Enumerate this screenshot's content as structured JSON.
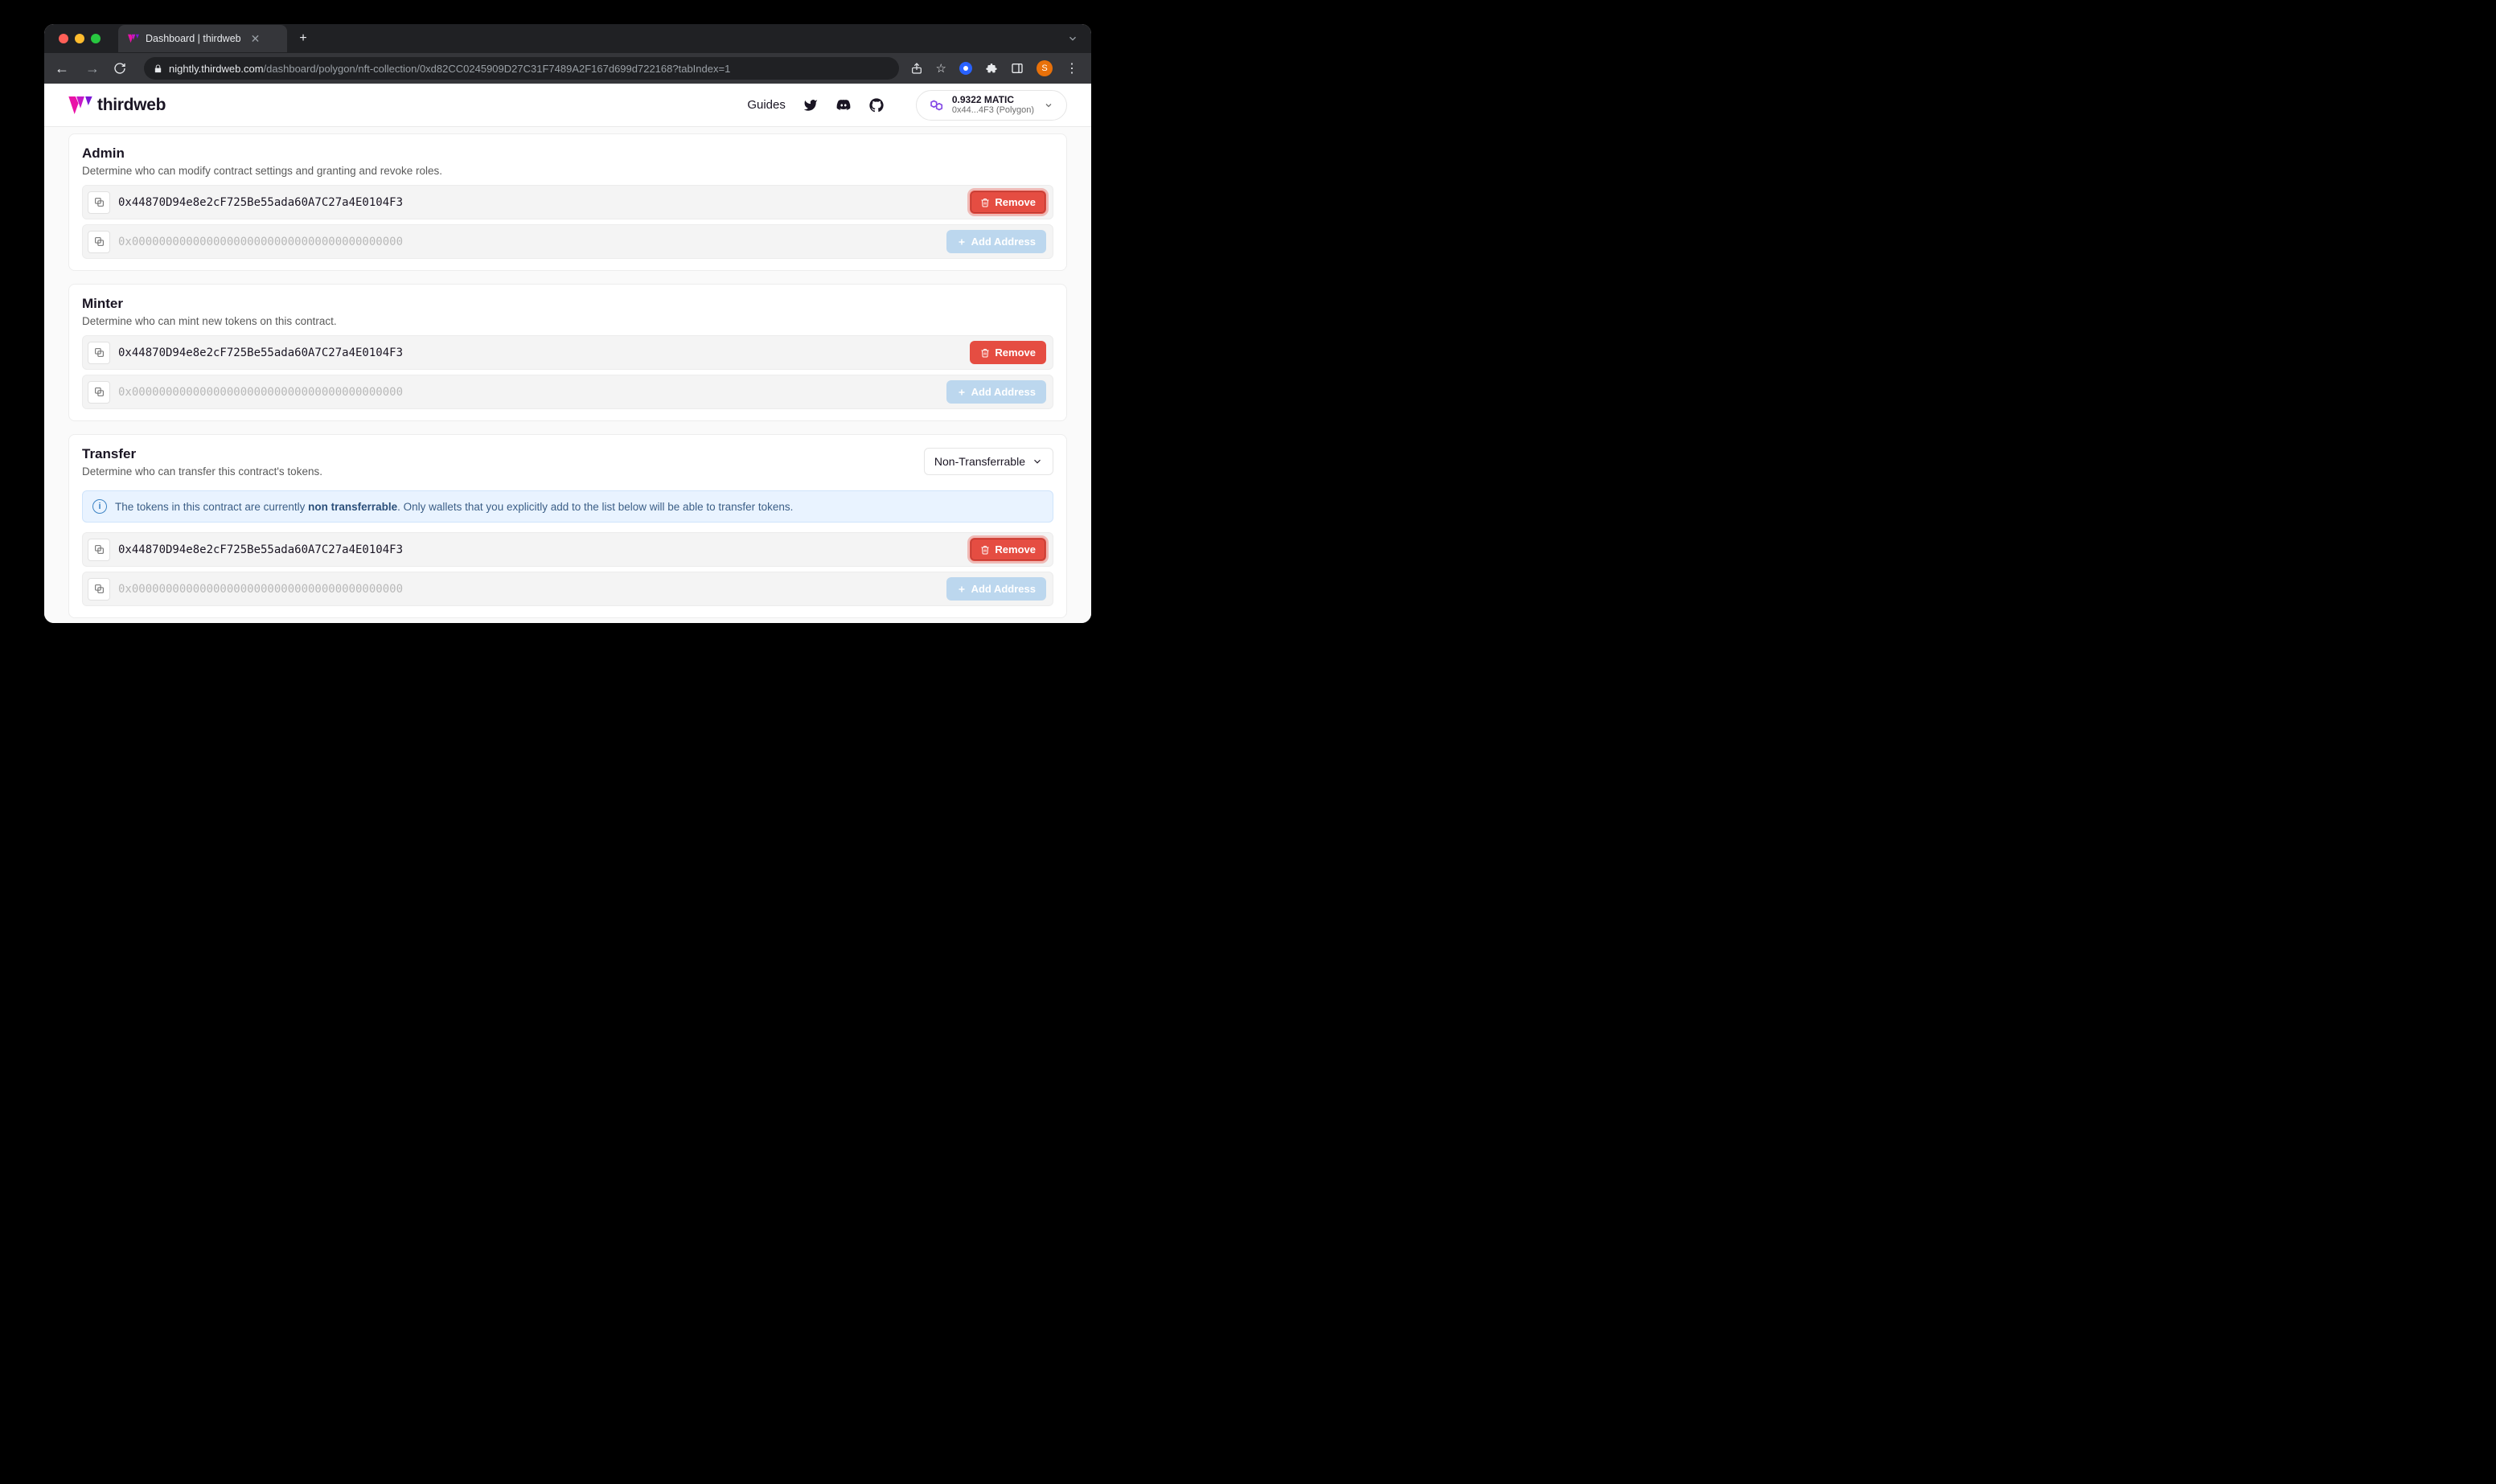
{
  "browser": {
    "tab_title": "Dashboard | thirdweb",
    "url_host": "nightly.thirdweb.com",
    "url_path": "/dashboard/polygon/nft-collection/0xd82CC0245909D27C31F7489A2F167d699d722168?tabIndex=1",
    "avatar_letter": "S"
  },
  "header": {
    "brand": "thirdweb",
    "guides_label": "Guides",
    "wallet_balance": "0.9322 MATIC",
    "wallet_short": "0x44...4F3 (Polygon)"
  },
  "labels": {
    "remove": "Remove",
    "add_address": "Add Address"
  },
  "placeholder_addr": "0x0000000000000000000000000000000000000000",
  "admin": {
    "title": "Admin",
    "desc": "Determine who can modify contract settings and granting and revoke roles.",
    "addr": "0x44870D94e8e2cF725Be55ada60A7C27a4E0104F3"
  },
  "minter": {
    "title": "Minter",
    "desc": "Determine who can mint new tokens on this contract.",
    "addr": "0x44870D94e8e2cF725Be55ada60A7C27a4E0104F3"
  },
  "transfer": {
    "title": "Transfer",
    "desc": "Determine who can transfer this contract's tokens.",
    "dropdown": "Non-Transferrable",
    "info_a": "The tokens in this contract are currently ",
    "info_b": "non transferrable",
    "info_c": ". Only wallets that you explicitly add to the list below will be able to transfer tokens.",
    "addr": "0x44870D94e8e2cF725Be55ada60A7C27a4E0104F3"
  }
}
